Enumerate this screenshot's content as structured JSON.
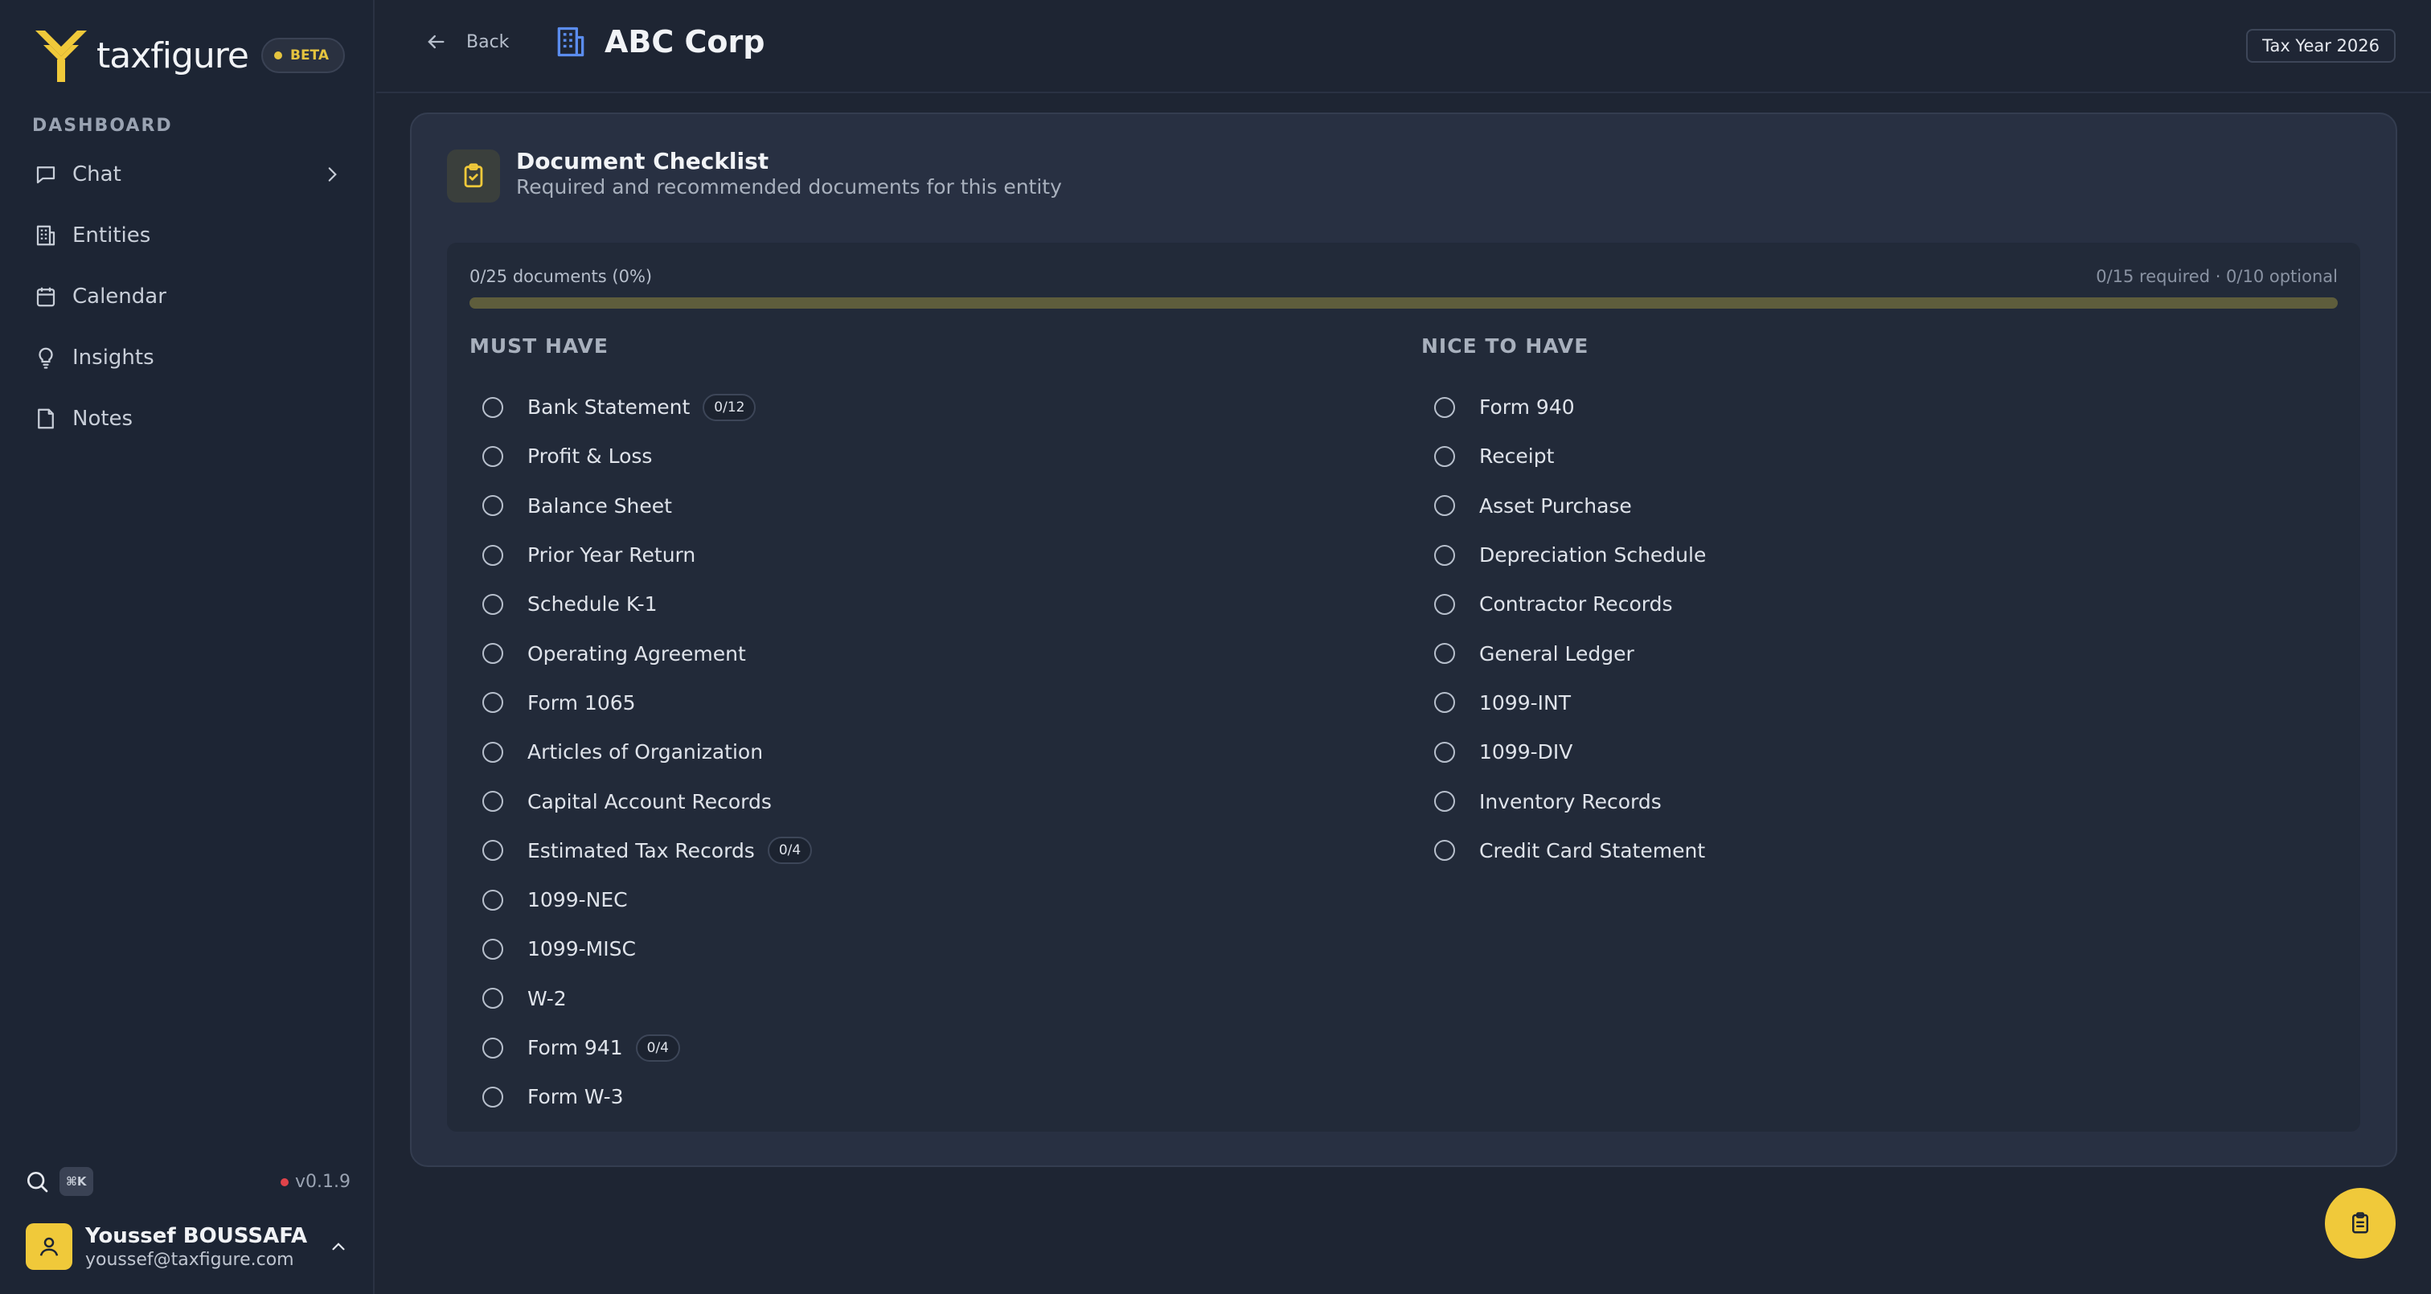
{
  "brand": {
    "name": "taxfigure",
    "badge": "BETA"
  },
  "sidebar": {
    "section_label": "DASHBOARD",
    "items": [
      {
        "label": "Chat",
        "icon": "chat-icon"
      },
      {
        "label": "Entities",
        "icon": "building-icon"
      },
      {
        "label": "Calendar",
        "icon": "calendar-icon"
      },
      {
        "label": "Insights",
        "icon": "lightbulb-icon"
      },
      {
        "label": "Notes",
        "icon": "note-icon"
      }
    ],
    "shortcut": "⌘K",
    "version": "v0.1.9",
    "user": {
      "name": "Youssef BOUSSAFA",
      "email": "youssef@taxfigure.com"
    }
  },
  "header": {
    "back_label": "Back",
    "entity_name": "ABC Corp",
    "tax_year": "Tax Year 2026"
  },
  "checklist": {
    "title": "Document Checklist",
    "subtitle": "Required and recommended documents for this entity",
    "progress_text": "0/25 documents (0%)",
    "progress_detail": "0/15 required · 0/10 optional",
    "progress_fraction": 0,
    "must_have_label": "MUST HAVE",
    "nice_to_have_label": "NICE TO HAVE",
    "must_have": [
      {
        "label": "Bank Statement",
        "count": "0/12"
      },
      {
        "label": "Profit & Loss"
      },
      {
        "label": "Balance Sheet"
      },
      {
        "label": "Prior Year Return"
      },
      {
        "label": "Schedule K-1"
      },
      {
        "label": "Operating Agreement"
      },
      {
        "label": "Form 1065"
      },
      {
        "label": "Articles of Organization"
      },
      {
        "label": "Capital Account Records"
      },
      {
        "label": "Estimated Tax Records",
        "count": "0/4"
      },
      {
        "label": "1099-NEC"
      },
      {
        "label": "1099-MISC"
      },
      {
        "label": "W-2"
      },
      {
        "label": "Form 941",
        "count": "0/4"
      },
      {
        "label": "Form W-3"
      }
    ],
    "nice_to_have": [
      {
        "label": "Form 940"
      },
      {
        "label": "Receipt"
      },
      {
        "label": "Asset Purchase"
      },
      {
        "label": "Depreciation Schedule"
      },
      {
        "label": "Contractor Records"
      },
      {
        "label": "General Ledger"
      },
      {
        "label": "1099-INT"
      },
      {
        "label": "1099-DIV"
      },
      {
        "label": "Inventory Records"
      },
      {
        "label": "Credit Card Statement"
      }
    ]
  },
  "colors": {
    "accent": "#f0c93a",
    "background": "#1e2533",
    "card": "#283042",
    "status_dot": "#e0434a"
  }
}
